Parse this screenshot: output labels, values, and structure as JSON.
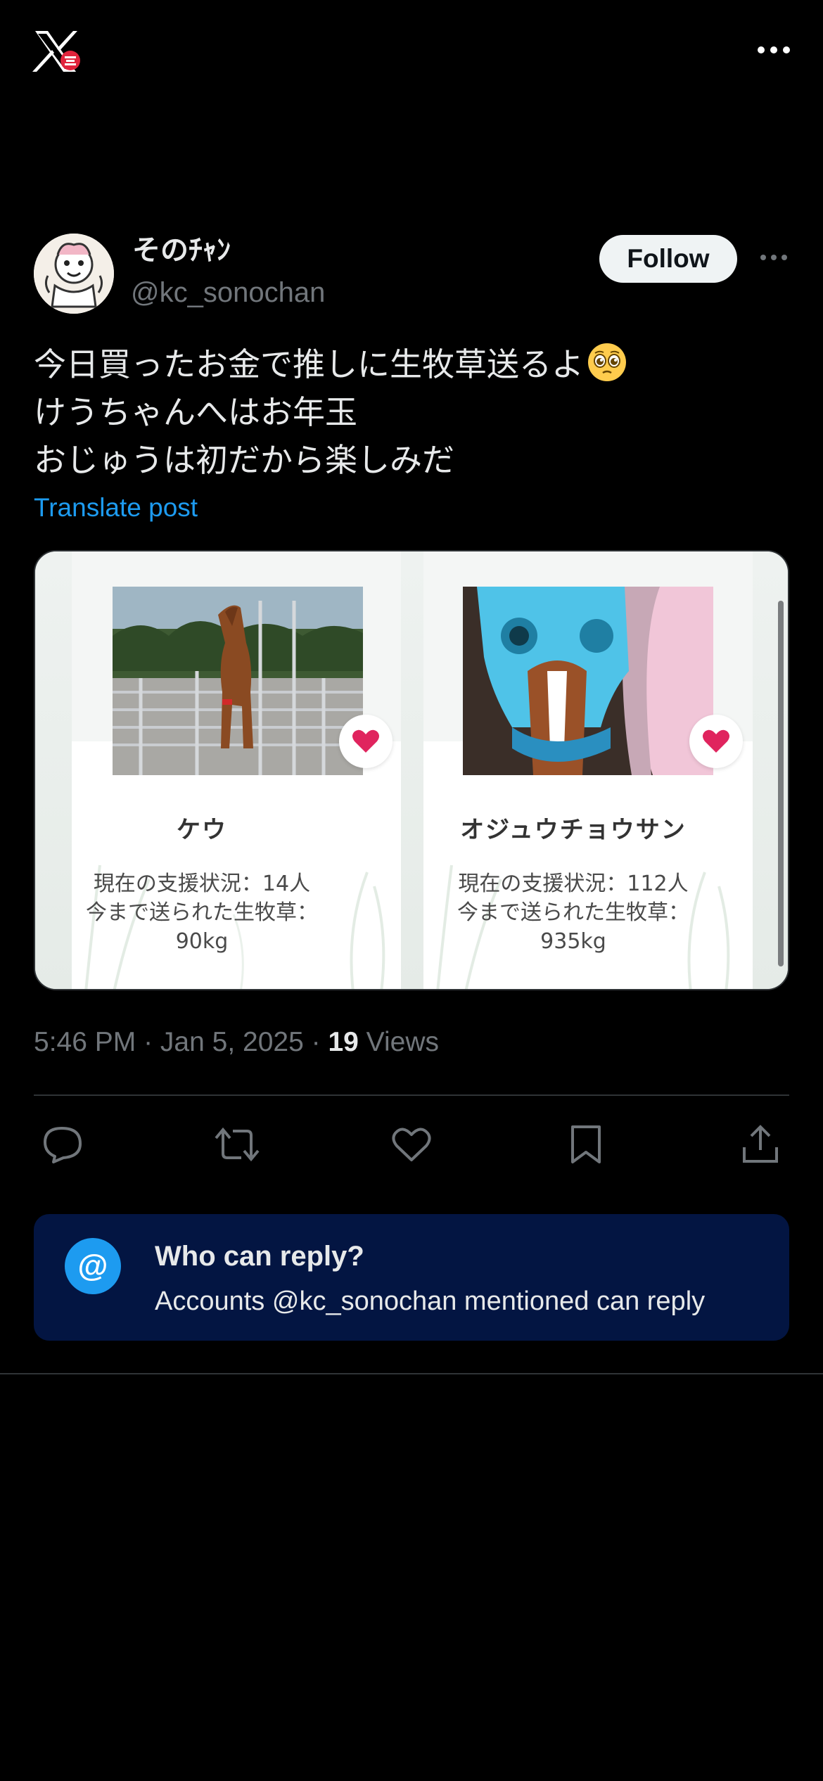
{
  "header": {
    "logo_icon": "x-logo-icon",
    "more_icon": "more-horizontal-icon"
  },
  "author": {
    "display_name": "そのﾁｬﾝ",
    "handle": "@kc_sonochan",
    "follow_label": "Follow",
    "avatar_icon": "avatar-illustration"
  },
  "tweet": {
    "lines": [
      "今日買ったお金で推しに生牧草送るよ",
      "けうちゃんへはお年玉",
      "おじゅうは初だから楽しみだ"
    ],
    "emoji": "pleading-face-emoji",
    "translate_label": "Translate post"
  },
  "media": {
    "cards": [
      {
        "name": "ケウ",
        "stat_line_1": "現在の支援状況：14人",
        "stat_line_2": "今まで送られた生牧草：",
        "stat_line_3": "90kg"
      },
      {
        "name": "オジュウチョウサン",
        "stat_line_1": "現在の支援状況：112人",
        "stat_line_2": "今まで送られた生牧草：",
        "stat_line_3": "935kg"
      }
    ]
  },
  "meta": {
    "time": "5:46 PM",
    "separator": " · ",
    "date": "Jan 5, 2025",
    "views_count": "19",
    "views_label": " Views"
  },
  "actions": {
    "reply_icon": "reply-icon",
    "repost_icon": "repost-icon",
    "like_icon": "heart-icon",
    "bookmark_icon": "bookmark-icon",
    "share_icon": "share-icon"
  },
  "reply_settings": {
    "icon_text": "@",
    "title": "Who can reply?",
    "description": "Accounts @kc_sonochan mentioned can reply"
  },
  "colors": {
    "background": "#000000",
    "text_primary": "#e7e9ea",
    "text_secondary": "#71767b",
    "accent": "#1d9bf0",
    "reply_box_bg": "#031542",
    "heart_red": "#e0245e"
  }
}
